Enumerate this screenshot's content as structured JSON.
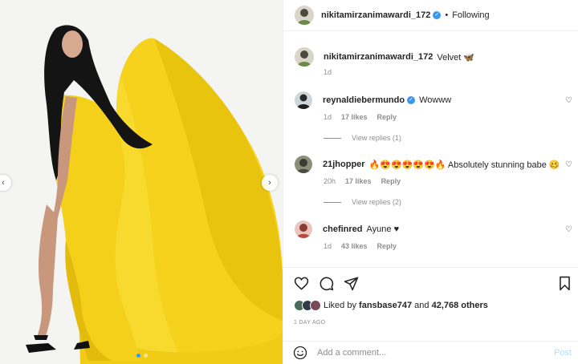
{
  "post": {
    "author": "nikitamirzanimawardi_172",
    "follow_label": "Following",
    "separator": "•",
    "caption": "Velvet 🦋",
    "caption_age": "1d"
  },
  "comments": [
    {
      "user": "reynaldiebermundo",
      "verified": true,
      "text": "Wowww",
      "age": "1d",
      "likes": "17 likes",
      "reply": "Reply",
      "view_replies": "View replies (1)"
    },
    {
      "user": "21jhopper",
      "verified": false,
      "text": "🔥😍😍😍😍😍🔥 Absolutely stunning babe 🥴",
      "age": "20h",
      "likes": "17 likes",
      "reply": "Reply",
      "view_replies": "View replies (2)"
    },
    {
      "user": "chefinred",
      "verified": false,
      "text": "Ayune ♥",
      "age": "1d",
      "likes": "43 likes",
      "reply": "Reply"
    }
  ],
  "likes": {
    "prefix": "Liked by",
    "first_user": "fansbase747",
    "conjunction": "and",
    "others": "42,768 others"
  },
  "timestamp": "1 DAY AGO",
  "composer": {
    "placeholder": "Add a comment...",
    "post_label": "Post"
  },
  "colors": {
    "accent": "#3897f0",
    "dress_yellow": "#f5d21d",
    "post_disabled": "#b2dffc"
  },
  "icons": {
    "like": "heart-icon",
    "comment": "comment-icon",
    "share": "share-icon",
    "save": "bookmark-icon",
    "emoji": "emoji-icon",
    "nav_prev": "chevron-left-icon",
    "nav_next": "chevron-right-icon"
  },
  "carousel": {
    "slide_count": 2,
    "active_index": 0
  }
}
